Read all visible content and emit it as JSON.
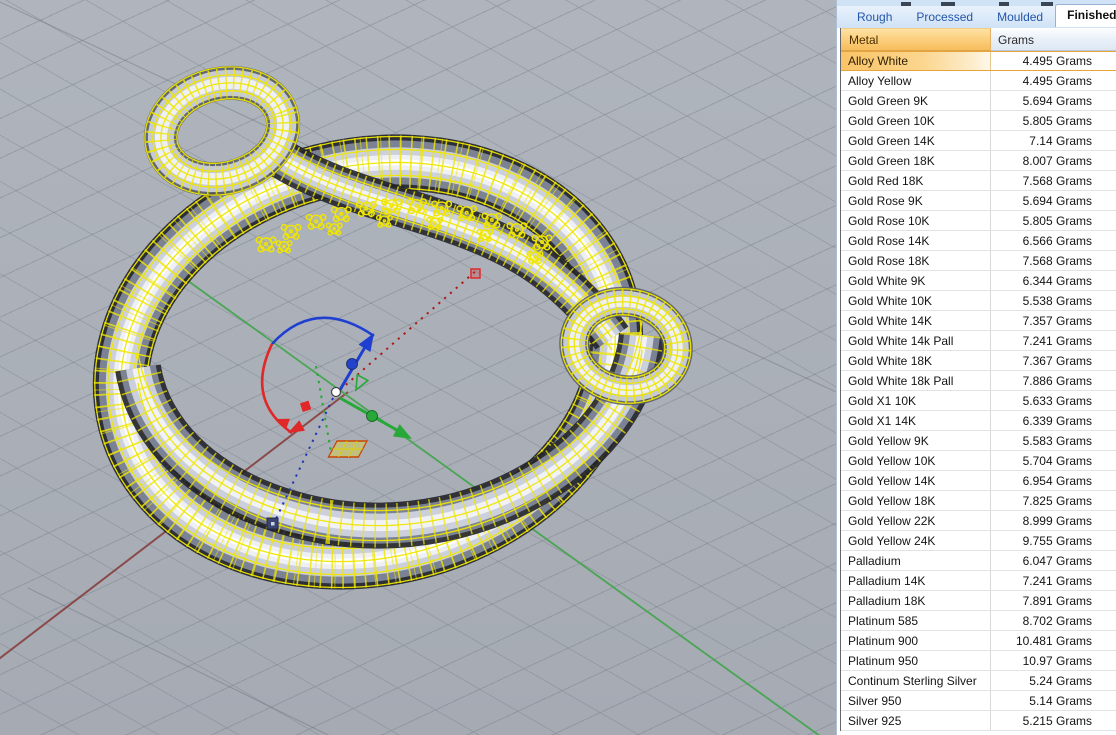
{
  "viewport": {
    "description": "3D CAD perspective view of a selected wrap-style ring shown as yellow wireframe over shaded metal, with move/rotate gumball widget and construction-plane axes",
    "background_color": "#a9afb8",
    "wireframe_selection_color": "#f0e600",
    "axis_x_color": "#8a4a4a",
    "axis_y_color": "#4aa555",
    "gumball_colors": {
      "x": "#e02828",
      "y": "#28a838",
      "z": "#2343cc"
    }
  },
  "panel": {
    "tabs": [
      {
        "label": "Rough",
        "active": false
      },
      {
        "label": "Processed",
        "active": false
      },
      {
        "label": "Moulded",
        "active": false
      },
      {
        "label": "Finished",
        "active": true
      }
    ],
    "colors": {
      "metal_header_bg": "#f8c05f",
      "grams_header_bg": "#e2ebf6",
      "selected_row_bg": "#fbc868",
      "tab_text": "#2456a8"
    },
    "table": {
      "headers": {
        "metal": "Metal",
        "grams": "Grams"
      },
      "selected_metal": "Alloy White",
      "rows": [
        {
          "metal": "Alloy White",
          "grams": "4.495 Grams",
          "selected": true
        },
        {
          "metal": "Alloy Yellow",
          "grams": "4.495 Grams",
          "selected": false
        },
        {
          "metal": "Gold Green 9K",
          "grams": "5.694 Grams",
          "selected": false
        },
        {
          "metal": "Gold Green 10K",
          "grams": "5.805 Grams",
          "selected": false
        },
        {
          "metal": "Gold Green 14K",
          "grams": "7.14 Grams",
          "selected": false
        },
        {
          "metal": "Gold Green 18K",
          "grams": "8.007 Grams",
          "selected": false
        },
        {
          "metal": "Gold Red 18K",
          "grams": "7.568 Grams",
          "selected": false
        },
        {
          "metal": "Gold Rose 9K",
          "grams": "5.694 Grams",
          "selected": false
        },
        {
          "metal": "Gold Rose 10K",
          "grams": "5.805 Grams",
          "selected": false
        },
        {
          "metal": "Gold Rose 14K",
          "grams": "6.566 Grams",
          "selected": false
        },
        {
          "metal": "Gold Rose 18K",
          "grams": "7.568 Grams",
          "selected": false
        },
        {
          "metal": "Gold White 9K",
          "grams": "6.344 Grams",
          "selected": false
        },
        {
          "metal": "Gold White 10K",
          "grams": "5.538 Grams",
          "selected": false
        },
        {
          "metal": "Gold White 14K",
          "grams": "7.357 Grams",
          "selected": false
        },
        {
          "metal": "Gold White 14k Pall",
          "grams": "7.241 Grams",
          "selected": false
        },
        {
          "metal": "Gold White 18K",
          "grams": "7.367 Grams",
          "selected": false
        },
        {
          "metal": "Gold White 18k Pall",
          "grams": "7.886 Grams",
          "selected": false
        },
        {
          "metal": "Gold X1 10K",
          "grams": "5.633 Grams",
          "selected": false
        },
        {
          "metal": "Gold X1 14K",
          "grams": "6.339 Grams",
          "selected": false
        },
        {
          "metal": "Gold Yellow 9K",
          "grams": "5.583 Grams",
          "selected": false
        },
        {
          "metal": "Gold Yellow 10K",
          "grams": "5.704 Grams",
          "selected": false
        },
        {
          "metal": "Gold Yellow 14K",
          "grams": "6.954 Grams",
          "selected": false
        },
        {
          "metal": "Gold Yellow 18K",
          "grams": "7.825 Grams",
          "selected": false
        },
        {
          "metal": "Gold Yellow 22K",
          "grams": "8.999 Grams",
          "selected": false
        },
        {
          "metal": "Gold Yellow 24K",
          "grams": "9.755 Grams",
          "selected": false
        },
        {
          "metal": "Palladium",
          "grams": "6.047 Grams",
          "selected": false
        },
        {
          "metal": "Palladium 14K",
          "grams": "7.241 Grams",
          "selected": false
        },
        {
          "metal": "Palladium 18K",
          "grams": "7.891 Grams",
          "selected": false
        },
        {
          "metal": "Platinum 585",
          "grams": "8.702 Grams",
          "selected": false
        },
        {
          "metal": "Platinum 900",
          "grams": "10.481 Grams",
          "selected": false
        },
        {
          "metal": "Platinum 950",
          "grams": "10.97 Grams",
          "selected": false
        },
        {
          "metal": "Continum Sterling Silver",
          "grams": "5.24 Grams",
          "selected": false
        },
        {
          "metal": "Silver 950",
          "grams": "5.14 Grams",
          "selected": false
        },
        {
          "metal": "Silver 925",
          "grams": "5.215 Grams",
          "selected": false
        }
      ]
    }
  }
}
